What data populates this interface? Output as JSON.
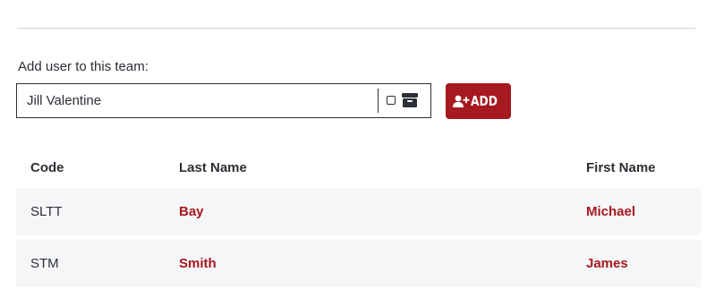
{
  "add_user": {
    "label": "Add user to this team:",
    "input_value": "Jill Valentine",
    "button_label": "ADD",
    "button_icon": "add-user-icon"
  },
  "table": {
    "headers": {
      "code": "Code",
      "last_name": "Last Name",
      "first_name": "First Name"
    },
    "rows": [
      {
        "code": "SLTT",
        "last_name": "Bay",
        "first_name": "Michael"
      },
      {
        "code": "STM",
        "last_name": "Smith",
        "first_name": "James"
      }
    ]
  },
  "colors": {
    "accent": "#a6191f",
    "text": "#2b2f36",
    "row_background": "#f5f6f8"
  }
}
